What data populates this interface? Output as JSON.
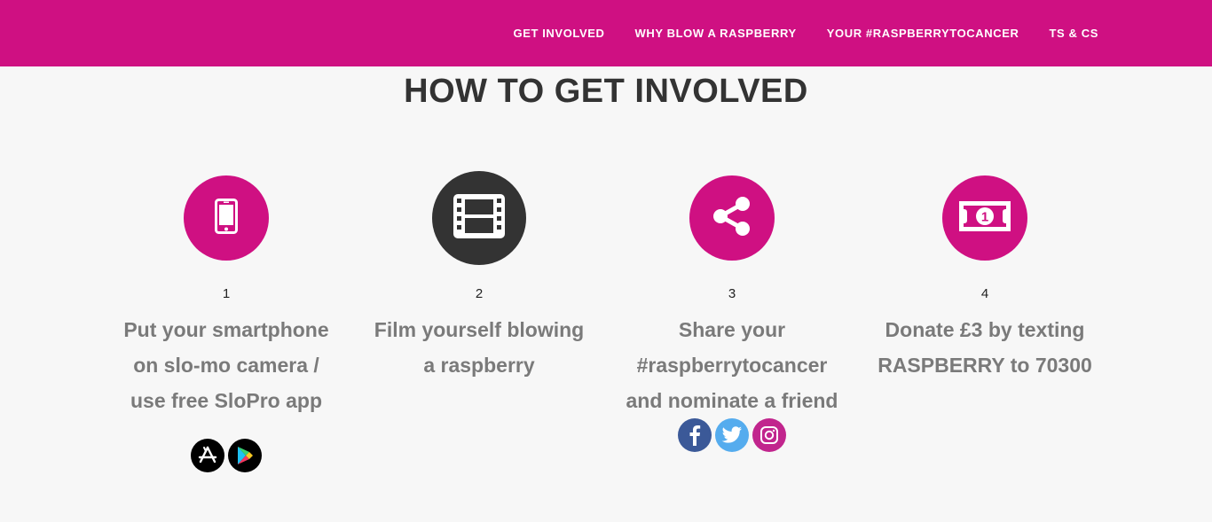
{
  "colors": {
    "brand_pink": "#cf1082",
    "dark_circle": "#333333",
    "facebook": "#3b5998",
    "twitter": "#55acee",
    "instagram": "#c1258d"
  },
  "nav": {
    "items": [
      {
        "label": "GET INVOLVED"
      },
      {
        "label": "WHY BLOW A RASPBERRY"
      },
      {
        "label": "YOUR #RASPBERRYTOCANCER"
      },
      {
        "label": "TS & CS"
      }
    ]
  },
  "main": {
    "title": "HOW TO GET INVOLVED",
    "steps": [
      {
        "number": "1",
        "icon": "smartphone-icon",
        "text_lines": [
          "Put your smartphone",
          "on slo-mo camera /",
          "use free SloPro app"
        ]
      },
      {
        "number": "2",
        "icon": "film-icon",
        "text_lines": [
          "Film yourself blowing",
          "a raspberry"
        ]
      },
      {
        "number": "3",
        "icon": "share-icon",
        "text_lines": [
          "Share your",
          "#raspberrytocancer",
          "and nominate a friend"
        ]
      },
      {
        "number": "4",
        "icon": "banknote-icon",
        "text_lines": [
          "Donate £3 by texting",
          "RASPBERRY to 70300"
        ]
      }
    ],
    "store_icons": [
      "app-store-icon",
      "google-play-icon"
    ],
    "social_icons": [
      "facebook-icon",
      "twitter-icon",
      "instagram-icon"
    ]
  }
}
